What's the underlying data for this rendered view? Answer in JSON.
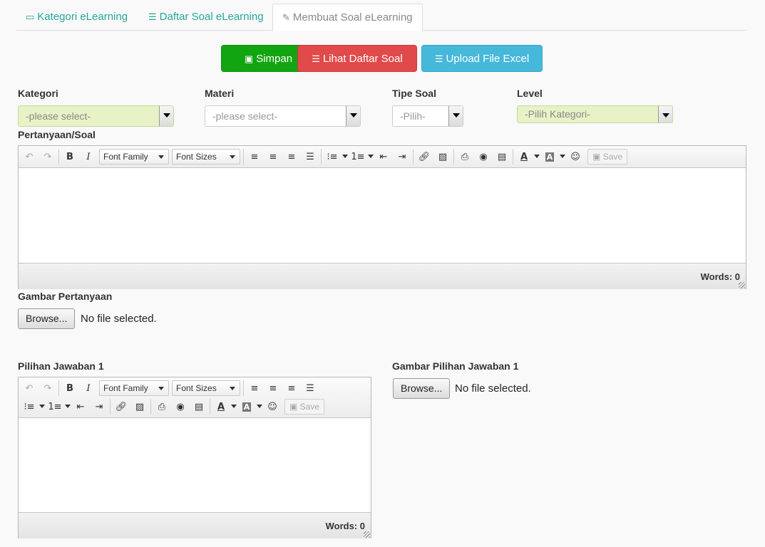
{
  "tabs": [
    {
      "label": "Kategori eLearning",
      "icon": "laptop-icon"
    },
    {
      "label": "Daftar Soal eLearning",
      "icon": "list-icon"
    },
    {
      "label": "Membuat Soal eLearning",
      "icon": "pencil-icon",
      "active": true
    }
  ],
  "actions": {
    "save": "Simpan",
    "list": "Lihat Daftar Soal",
    "upload": "Upload File Excel"
  },
  "colors": {
    "tab_text": "#26a69a",
    "save_btn": "#12a512",
    "list_btn": "#e04a4a",
    "upload_btn": "#46b8da",
    "highlight_select": "#e7f2c6"
  },
  "form": {
    "kategori": {
      "label": "Kategori",
      "value": "-please select-"
    },
    "materi": {
      "label": "Materi",
      "value": "-please select-"
    },
    "tipe": {
      "label": "Tipe Soal",
      "value": "-Pilih-"
    },
    "level": {
      "label": "Level",
      "value": "-Pilih Kategori-"
    },
    "pertanyaan_label": "Pertanyaan/Soal",
    "gambar_pertanyaan_label": "Gambar Pertanyaan",
    "jawaban1_label": "Pilihan Jawaban 1",
    "gambar_jawaban1_label": "Gambar Pilihan Jawaban 1"
  },
  "editor": {
    "font_family": "Font Family",
    "font_sizes": "Font Sizes",
    "save": "Save",
    "words": "Words: 0"
  },
  "file": {
    "browse": "Browse...",
    "none": "No file selected."
  }
}
